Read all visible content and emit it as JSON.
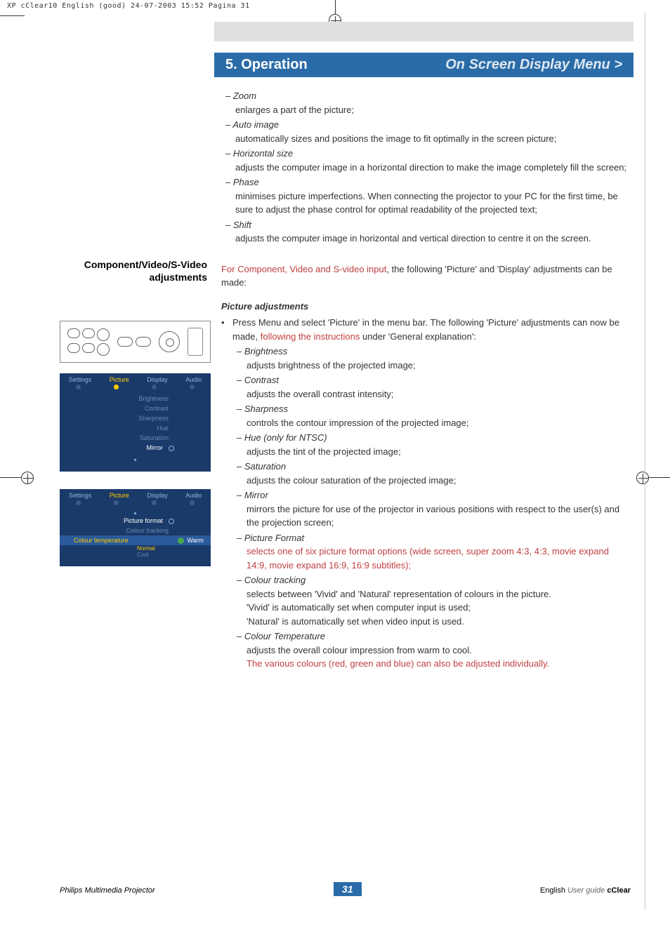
{
  "proofHeader": "XP cClear10 English (good)  24-07-2003  15:52  Pagina 31",
  "section": {
    "number": "5. Operation",
    "breadcrumb": "On Screen Display Menu >"
  },
  "topDefs": [
    {
      "label": "– Zoom",
      "desc": "enlarges a part of the picture;"
    },
    {
      "label": "– Auto image",
      "desc": "automatically sizes and positions the image to fit optimally in the screen picture;"
    },
    {
      "label": "– Horizontal size",
      "desc": "adjusts the computer image in a horizontal direction to make the image completely fill the screen;"
    },
    {
      "label": "– Phase",
      "desc": "minimises picture imperfections. When connecting the projector to your PC for the first time, be sure to adjust the phase control for optimal readability of the projected text;"
    },
    {
      "label": "– Shift",
      "desc": "adjusts the computer image in horizontal and vertical direction to centre it on the screen."
    }
  ],
  "sidebarHeading": "Component/Video/S-Video adjustments",
  "componentIntro": {
    "pre": "For Component, Video and S-video input",
    "post": ", the following 'Picture' and 'Display' adjustments can be made:"
  },
  "pictureAdj": {
    "heading": "Picture adjustments",
    "bulletPre": "Press Menu and select 'Picture' in the menu bar. The following 'Picture' adjustments can now be made, ",
    "bulletMid": "following the instructions",
    "bulletPost": " under 'General explanation':",
    "items": [
      {
        "label": "– Brightness",
        "desc": "adjusts brightness of the projected image;"
      },
      {
        "label": "– Contrast",
        "desc": "adjusts the overall contrast intensity;"
      },
      {
        "label": "– Sharpness",
        "desc": "controls the contour impression of the projected image;"
      },
      {
        "label": "– Hue (only for NTSC)",
        "desc": "adjusts the tint of the projected image;"
      },
      {
        "label": "– Saturation",
        "desc": "adjusts the colour saturation of the projected image;"
      },
      {
        "label": "– Mirror",
        "desc": "mirrors the picture for use of the projector in various positions with respect to the user(s) and the projection screen;"
      },
      {
        "label": "– Picture Format",
        "desc": "selects one of six picture format options (wide screen, super zoom 4:3, 4:3, movie expand 14:9, movie expand 16:9, 16:9 subtitles);",
        "highlight": true
      },
      {
        "label": "– Colour tracking",
        "desc": "selects between 'Vivid' and 'Natural' representation of colours in the picture.\n'Vivid' is automatically set when computer input is used;\n'Natural' is automatically set when video input is used."
      },
      {
        "label": "– Colour Temperature",
        "desc": "adjusts the overall colour impression from warm to cool.",
        "extraHighlight": "The various colours (red, green and blue) can also be adjusted individually."
      }
    ]
  },
  "menuTabs": [
    "Settings",
    "Picture",
    "Display",
    "Audio"
  ],
  "menu1Items": [
    "Brightness",
    "Contrast",
    "Sharpness",
    "Hue",
    "Saturation",
    "Mirror"
  ],
  "menu2": {
    "items": [
      "Picture format",
      "Colour tracking",
      "Colour temperature"
    ],
    "sub": [
      "Warm",
      "Normal",
      "Cool"
    ]
  },
  "footer": {
    "left": "Philips Multimedia Projector",
    "page": "31",
    "lang": "English",
    "guide": "User guide",
    "brand": "cClear"
  }
}
